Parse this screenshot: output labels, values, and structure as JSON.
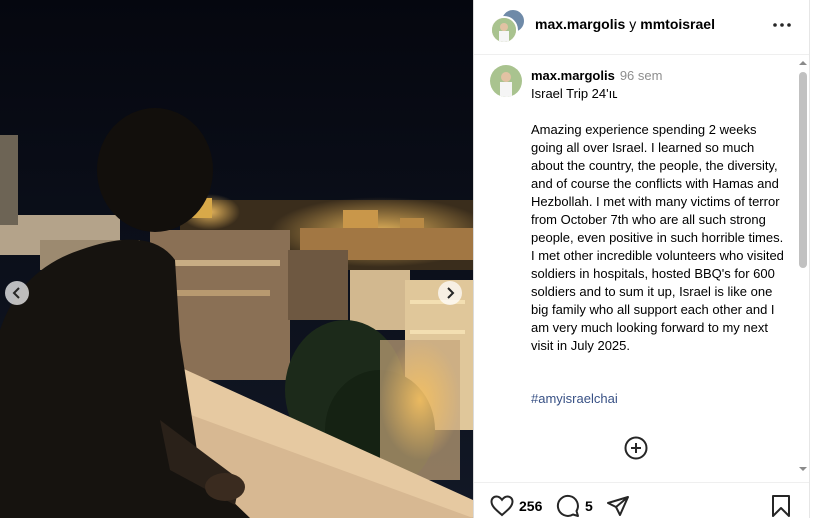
{
  "header": {
    "user1": "max.margolis",
    "joiner": "y",
    "user2": "mmtoisrael",
    "more_icon": "more-horizontal-icon"
  },
  "caption": {
    "username": "max.margolis",
    "time": "96 sem",
    "title": "Israel Trip 24'ıʟ",
    "body": "Amazing experience spending 2 weeks going all over Israel. I learned so much about the country, the people, the diversity, and of course the conflicts with Hamas and Hezbollah. I met with many victims of terror from October 7th who are all such strong people, even positive in such horrible times. I met other incredible volunteers who visited soldiers in hospitals, hosted BBQ's for 600 soldiers and to sum it up, Israel is like one big family who all support each other and I am very much looking forward to my next visit in July 2025.",
    "hashtag": "#amyisraelchai"
  },
  "actions": {
    "likes": "256",
    "comments": "5"
  },
  "icons": {
    "prev": "chevron-left-icon",
    "next": "chevron-right-icon",
    "add_comment": "plus-circle-icon",
    "like": "heart-icon",
    "comment": "comment-icon",
    "share": "send-icon",
    "save": "bookmark-icon"
  },
  "colors": {
    "link": "#385185",
    "muted": "#8e8e8e",
    "divider": "#dbdbdb"
  }
}
